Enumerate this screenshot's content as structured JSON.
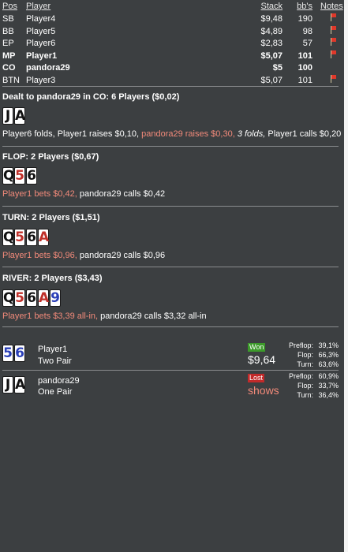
{
  "table": {
    "headers": {
      "pos": "Pos",
      "player": "Player",
      "stack": "Stack",
      "bb": "bb's",
      "notes": "Notes"
    },
    "rows": [
      {
        "pos": "SB",
        "player": "Player4",
        "stack": "$9,48",
        "bb": "190",
        "flag": true,
        "bold": false
      },
      {
        "pos": "BB",
        "player": "Player5",
        "stack": "$4,89",
        "bb": "98",
        "flag": true,
        "bold": false
      },
      {
        "pos": "EP",
        "player": "Player6",
        "stack": "$2,83",
        "bb": "57",
        "flag": true,
        "bold": false
      },
      {
        "pos": "MP",
        "player": "Player1",
        "stack": "$5,07",
        "bb": "101",
        "flag": true,
        "bold": true
      },
      {
        "pos": "CO",
        "player": "pandora29",
        "stack": "$5",
        "bb": "100",
        "flag": false,
        "bold": true
      },
      {
        "pos": "BTN",
        "player": "Player3",
        "stack": "$5,07",
        "bb": "101",
        "flag": true,
        "bold": false
      }
    ]
  },
  "preflop": {
    "title": "Dealt to pandora29 in CO: 6 Players ($0,02)",
    "cards": [
      {
        "rank": "J",
        "color": "black"
      },
      {
        "rank": "A",
        "color": "black"
      }
    ],
    "actions": {
      "a1": "Player6 folds, Player1 raises $0,10,",
      "a2": "pandora29 raises $0,30,",
      "a3": "3 folds,",
      "a4": "Player1 calls $0,20"
    }
  },
  "flop": {
    "title": "FLOP: 2 Players ($0,67)",
    "cards": [
      {
        "rank": "Q",
        "color": "black"
      },
      {
        "rank": "5",
        "color": "red"
      },
      {
        "rank": "6",
        "color": "black"
      }
    ],
    "actions": {
      "a1": "Player1 bets $0,42,",
      "a2": "pandora29 calls $0,42"
    }
  },
  "turn": {
    "title": "TURN: 2 Players ($1,51)",
    "cards": [
      {
        "rank": "Q",
        "color": "black"
      },
      {
        "rank": "5",
        "color": "red"
      },
      {
        "rank": "6",
        "color": "black"
      },
      {
        "rank": "A",
        "color": "red"
      }
    ],
    "actions": {
      "a1": "Player1 bets $0,96,",
      "a2": "pandora29 calls $0,96"
    }
  },
  "river": {
    "title": "RIVER: 2 Players ($3,43)",
    "cards": [
      {
        "rank": "Q",
        "color": "black"
      },
      {
        "rank": "5",
        "color": "red"
      },
      {
        "rank": "6",
        "color": "black"
      },
      {
        "rank": "A",
        "color": "red"
      },
      {
        "rank": "9",
        "color": "blue"
      }
    ],
    "actions": {
      "a1": "Player1 bets $3,39 all-in,",
      "a2": "pandora29 calls $3,32 all-in"
    }
  },
  "results": [
    {
      "name": "Player1",
      "hand": "Two Pair",
      "cards": [
        {
          "rank": "5",
          "color": "blue"
        },
        {
          "rank": "6",
          "color": "blue"
        }
      ],
      "badge": "Won",
      "amount": "$9,64",
      "equity": [
        {
          "label": "Preflop:",
          "value": "39,1%"
        },
        {
          "label": "Flop:",
          "value": "66,3%"
        },
        {
          "label": "Turn:",
          "value": "63,6%"
        }
      ]
    },
    {
      "name": "pandora29",
      "hand": "One Pair",
      "cards": [
        {
          "rank": "J",
          "color": "black"
        },
        {
          "rank": "A",
          "color": "black"
        }
      ],
      "badge": "Lost",
      "amount": "shows",
      "equity": [
        {
          "label": "Preflop:",
          "value": "60,9%"
        },
        {
          "label": "Flop:",
          "value": "33,7%"
        },
        {
          "label": "Turn:",
          "value": "36,4%"
        }
      ]
    }
  ],
  "colors": {
    "background": "#3c3f41",
    "highlight": "#f28a7a",
    "won": "#3c9a2a",
    "lost": "#c22a2a",
    "card_red": "#c0302a",
    "card_blue": "#2a3fb8"
  }
}
